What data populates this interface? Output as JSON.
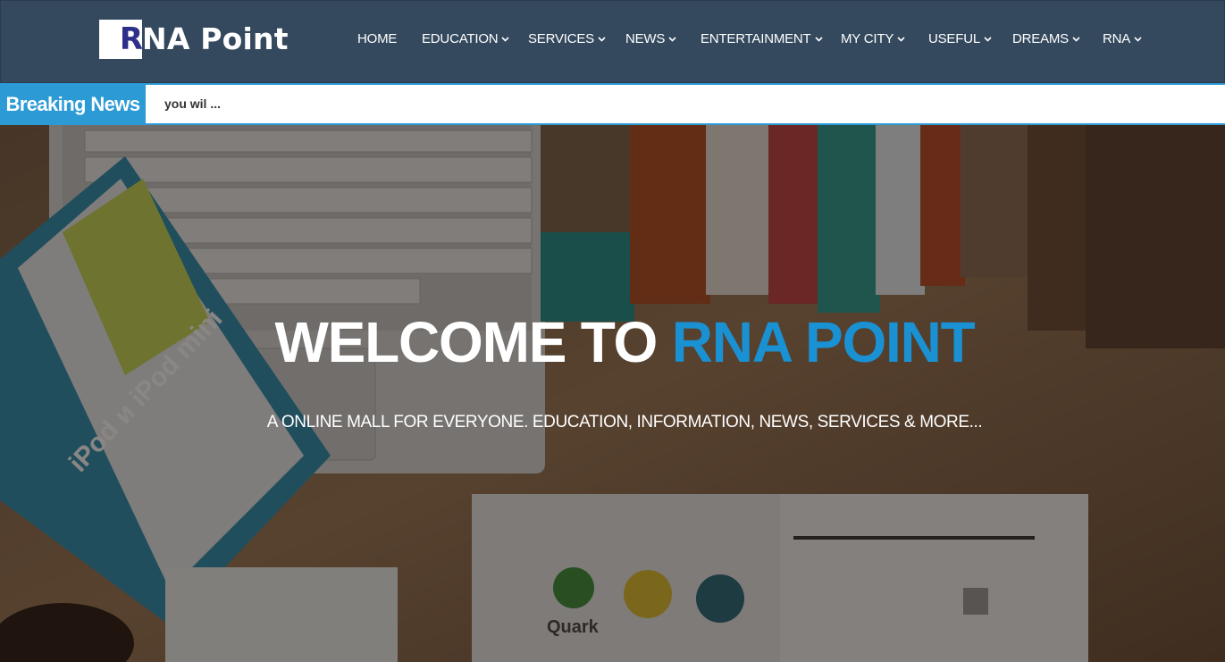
{
  "brand": {
    "logo_initial": "R",
    "logo_rest": "NA Point"
  },
  "nav": {
    "items": [
      {
        "label": "HOME",
        "dropdown": false
      },
      {
        "label": "EDUCATION",
        "dropdown": true
      },
      {
        "label": "SERVICES",
        "dropdown": true
      },
      {
        "label": "NEWS",
        "dropdown": true
      },
      {
        "label": "ENTERTAINMENT",
        "dropdown": true
      },
      {
        "label": "MY CITY",
        "dropdown": true
      },
      {
        "label": "USEFUL",
        "dropdown": true
      },
      {
        "label": "DREAMS",
        "dropdown": true
      },
      {
        "label": "RNA",
        "dropdown": true
      }
    ]
  },
  "ticker": {
    "label": "Breaking News",
    "text": "you wil ..."
  },
  "hero": {
    "title_white": "WELCOME TO ",
    "title_blue": "RNA POINT",
    "subtitle": "A ONLINE MALL FOR EVERYONE. EDUCATION, INFORMATION, NEWS, SERVICES & MORE...",
    "image_text": {
      "ipod": "iPod и iPod mini",
      "quark": "Quark"
    }
  },
  "colors": {
    "header_bg": "#34495e",
    "accent_blue": "#2b9ad5",
    "title_blue": "#1a91d3",
    "logo_purple": "#2e2f8a"
  }
}
